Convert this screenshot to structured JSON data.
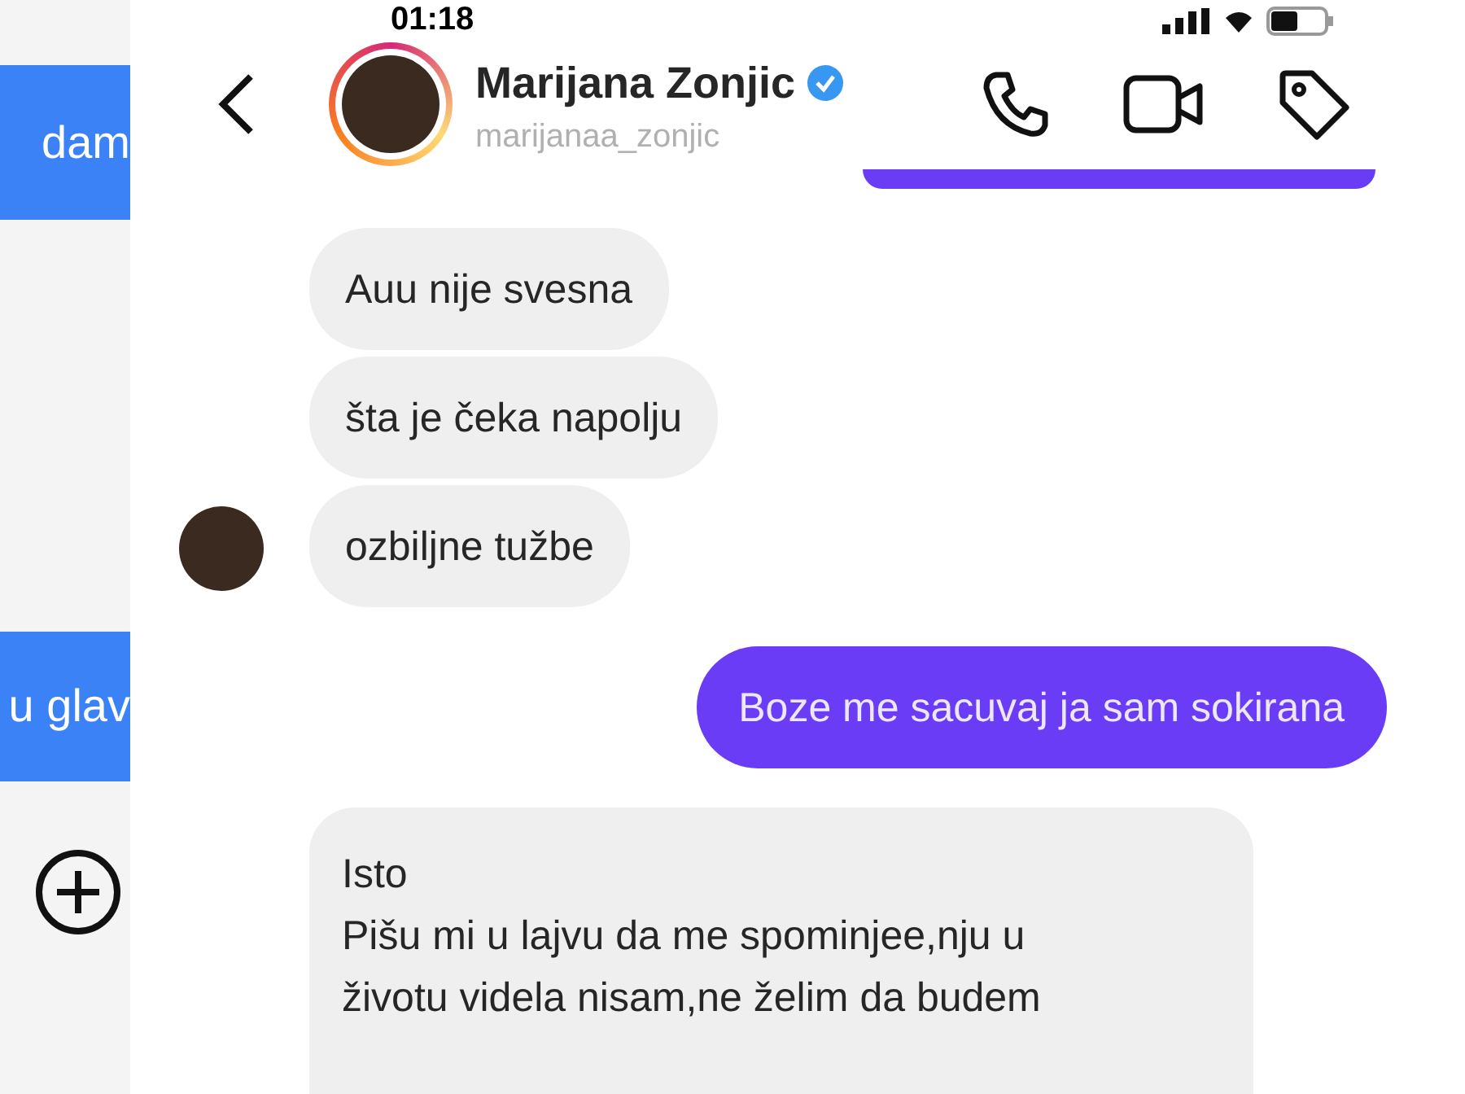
{
  "status_bar": {
    "time": "01:18"
  },
  "background_chat": {
    "messages": [
      {
        "text": "dam"
      },
      {
        "text": "u glav"
      }
    ]
  },
  "header": {
    "name": "Marijana Zonjic",
    "verified": true,
    "username": "marijanaa_zonjic"
  },
  "messages": [
    {
      "kind": "incoming",
      "avatar": false,
      "lines": [
        "Auu nije svesna"
      ]
    },
    {
      "kind": "incoming",
      "avatar": false,
      "lines": [
        "šta je čeka napolju"
      ]
    },
    {
      "kind": "incoming",
      "avatar": true,
      "lines": [
        "ozbiljne tužbe"
      ]
    },
    {
      "kind": "outgoing",
      "lines": [
        "Boze me sacuvaj ja sam sokirana"
      ]
    },
    {
      "kind": "incoming",
      "avatar": false,
      "lines": [
        "Isto",
        "Pišu mi u lajvu da me spominjee,nju u",
        "životu videla nisam,ne želim da budem"
      ]
    }
  ]
}
